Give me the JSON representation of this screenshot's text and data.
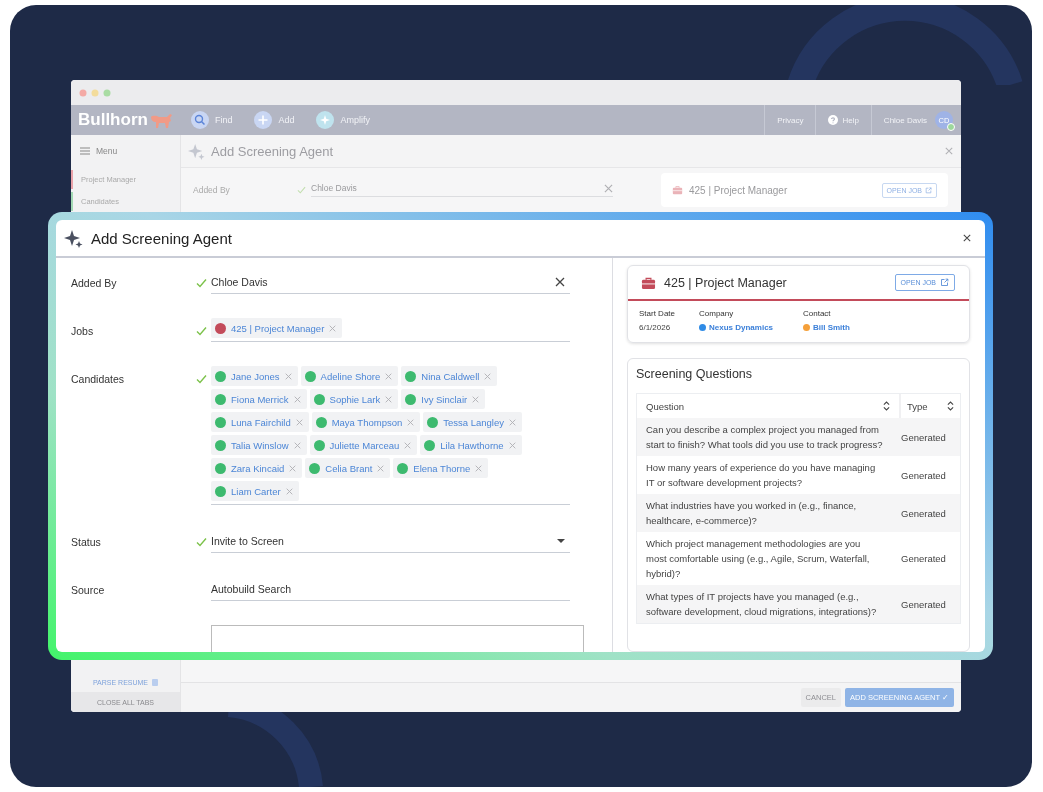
{
  "app_window": {
    "nav": {
      "logo": "Bullhorn",
      "items": [
        {
          "label": "Find",
          "kind": "search"
        },
        {
          "label": "Add",
          "kind": "add"
        },
        {
          "label": "Amplify",
          "kind": "amplify"
        }
      ],
      "links": [
        "Privacy",
        "Help"
      ],
      "user": "Chloe Davis",
      "avatar": {
        "initials": "CD",
        "online": true
      }
    },
    "sidebar": {
      "menu": "Menu",
      "items": [
        {
          "label": "Project Manager",
          "color": "#eaa3aa"
        },
        {
          "label": "Candidates",
          "color": "#a3d9b4"
        }
      ],
      "parse_resume": "PARSE RESUME",
      "close_all_tabs": "CLOSE ALL TABS"
    },
    "panel": {
      "title": "Add Screening Agent",
      "added_by_label": "Added By",
      "added_by_value": "Chloe Davis",
      "job_title": "425 | Project Manager",
      "open_job": "OPEN JOB"
    },
    "buttons": [
      {
        "label": "CANCEL",
        "kind": "secondary"
      },
      {
        "label": "ADD SCREENING AGENT ✓",
        "kind": "primary"
      }
    ]
  },
  "modal": {
    "title": "Add Screening Agent",
    "fields": [
      {
        "kind": "text",
        "label": "Added By",
        "valid": true,
        "value": "Chloe Davis",
        "clearable": true
      },
      {
        "kind": "chips",
        "label": "Jobs",
        "valid": true,
        "chips": [
          {
            "label": "425 | Project Manager",
            "color": "#c34b5a"
          }
        ]
      },
      {
        "kind": "chips",
        "label": "Candidates",
        "valid": true,
        "chips": [
          {
            "label": "Jane Jones",
            "color": "#3dba6f"
          },
          {
            "label": "Adeline Shore",
            "color": "#3dba6f"
          },
          {
            "label": "Nina Caldwell",
            "color": "#3dba6f"
          },
          {
            "label": "Fiona Merrick",
            "color": "#3dba6f"
          },
          {
            "label": "Sophie Lark",
            "color": "#3dba6f"
          },
          {
            "label": "Ivy Sinclair",
            "color": "#3dba6f"
          },
          {
            "label": "Luna Fairchild",
            "color": "#3dba6f"
          },
          {
            "label": "Maya Thompson",
            "color": "#3dba6f"
          },
          {
            "label": "Tessa Langley",
            "color": "#3dba6f"
          },
          {
            "label": "Talia Winslow",
            "color": "#3dba6f"
          },
          {
            "label": "Juliette Marceau",
            "color": "#3dba6f"
          },
          {
            "label": "Lila Hawthorne",
            "color": "#3dba6f"
          },
          {
            "label": "Zara Kincaid",
            "color": "#3dba6f"
          },
          {
            "label": "Celia Brant",
            "color": "#3dba6f"
          },
          {
            "label": "Elena Thorne",
            "color": "#3dba6f"
          },
          {
            "label": "Liam Carter",
            "color": "#3dba6f"
          }
        ]
      },
      {
        "kind": "select",
        "label": "Status",
        "valid": true,
        "value": "Invite to Screen"
      },
      {
        "kind": "text",
        "label": "Source",
        "valid": false,
        "value": "Autobuild Search",
        "clearable": false
      }
    ],
    "job_card": {
      "title": "425 | Project Manager",
      "open_job": "OPEN JOB",
      "details": [
        {
          "label": "Start Date",
          "value": "6/1/2026"
        },
        {
          "label": "Company",
          "value": "Nexus Dynamics",
          "color": "#2f8be6"
        },
        {
          "label": "Contact",
          "value": "Bill Smith",
          "color": "#f5a03a"
        }
      ]
    },
    "screening": {
      "title": "Screening Questions",
      "columns": [
        "Question",
        "Type"
      ],
      "rows": [
        {
          "question": "Can you describe a complex project you managed from start to finish? What tools did you use to track progress?",
          "type": "Generated"
        },
        {
          "question": "How many years of experience do you have managing IT or software development projects?",
          "type": "Generated"
        },
        {
          "question": "What industries have you worked in (e.g., finance, healthcare, e-commerce)?",
          "type": "Generated"
        },
        {
          "question": "Which project management methodologies are you most comfortable using (e.g., Agile, Scrum, Waterfall, hybrid)?",
          "type": "Generated"
        },
        {
          "question": "What types of IT projects have you managed (e.g., software development, cloud migrations, integrations)?",
          "type": "Generated"
        }
      ]
    }
  }
}
